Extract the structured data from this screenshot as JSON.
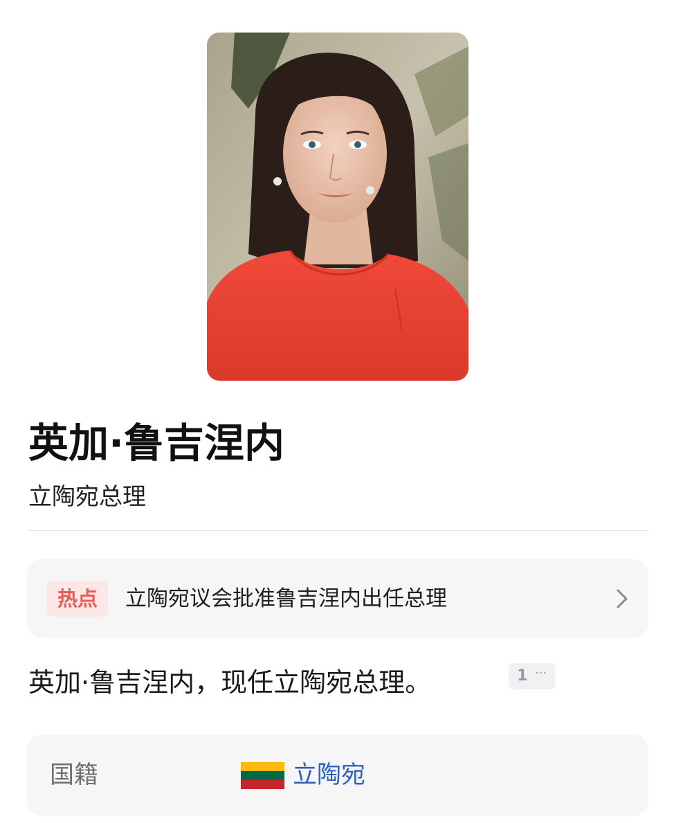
{
  "profile": {
    "name": "英加·鲁吉涅内",
    "title": "立陶宛总理"
  },
  "hot_topic": {
    "badge": "热点",
    "headline": "立陶宛议会批准鲁吉涅内出任总理"
  },
  "summary": {
    "text": "英加·鲁吉涅内，现任立陶宛总理。",
    "ref_number": "1",
    "ref_more": "···"
  },
  "info": {
    "nationality_label": "国籍",
    "nationality_value": "立陶宛",
    "flag_icon": "lithuania-flag-icon",
    "flag_colors": [
      "#fdb913",
      "#006a44",
      "#c1272d"
    ]
  },
  "colors": {
    "hot_badge_text": "#ea5a56",
    "hot_badge_bg": "#fde6e6",
    "link": "#2d62b8",
    "card_bg": "#f6f6f6"
  }
}
